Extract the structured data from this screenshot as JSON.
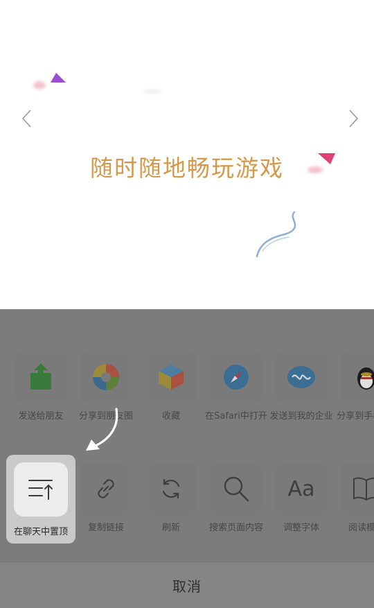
{
  "banner": {
    "slogan": "随时随地畅玩游戏"
  },
  "share_sheet": {
    "row1": [
      {
        "label": "发送给朋友",
        "icon": "send-to-friend-icon"
      },
      {
        "label": "分享到朋友圈",
        "icon": "moments-icon"
      },
      {
        "label": "收藏",
        "icon": "favorites-cube-icon"
      },
      {
        "label": "在Safari中打开",
        "icon": "safari-compass-icon"
      },
      {
        "label": "发送到我的企业",
        "icon": "enterprise-icon"
      },
      {
        "label": "分享到手机QQ",
        "icon": "qq-penguin-icon"
      }
    ],
    "row2": [
      {
        "label": "在聊天中置顶",
        "icon": "pin-to-top-icon"
      },
      {
        "label": "复制链接",
        "icon": "link-icon"
      },
      {
        "label": "刷新",
        "icon": "refresh-icon"
      },
      {
        "label": "搜索页面内容",
        "icon": "search-icon"
      },
      {
        "label": "调整字体",
        "icon": "font-icon"
      },
      {
        "label": "阅读模式",
        "icon": "book-icon"
      }
    ],
    "row2_glyphs": {
      "font": "Aa"
    },
    "cancel_label": "取消"
  },
  "colors": {
    "slogan": "#d4994b",
    "overlay": "#7c7c7c",
    "highlight": "#c9c9c9"
  }
}
